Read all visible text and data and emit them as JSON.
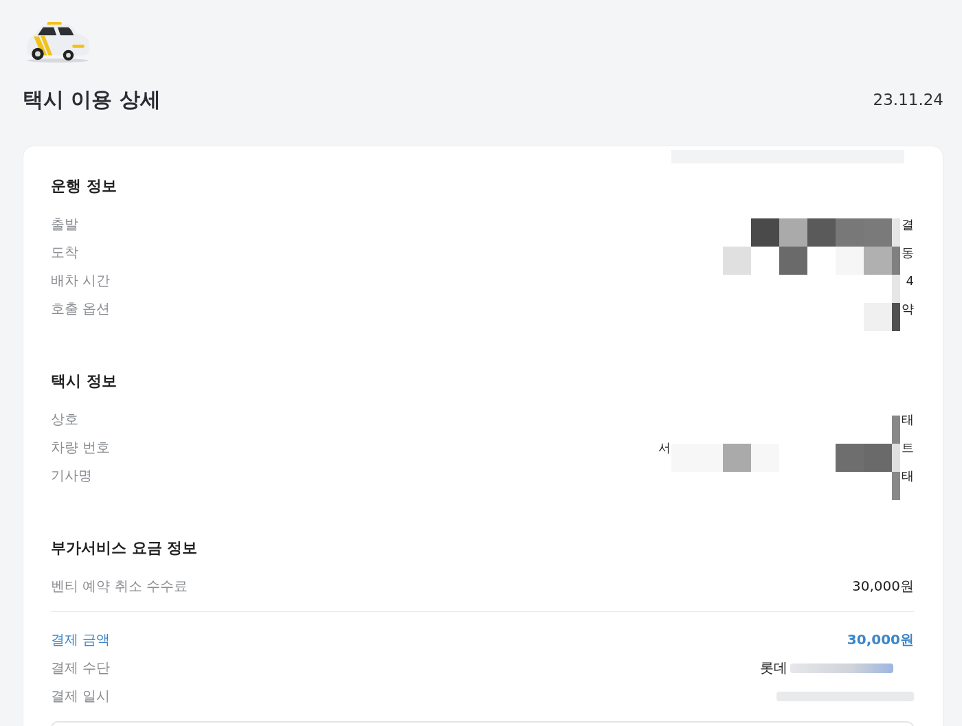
{
  "header": {
    "title": "택시 이용 상세",
    "date": "23.11.24"
  },
  "sections": [
    {
      "kind": "info",
      "heading": "운행 정보",
      "rows": [
        {
          "label": "출발",
          "value": "결"
        },
        {
          "label": "도착",
          "value": "동"
        },
        {
          "label": "배차 시간",
          "value": "4"
        },
        {
          "label": "호출 옵션",
          "value": "약"
        }
      ]
    },
    {
      "kind": "info",
      "heading": "택시 정보",
      "rows": [
        {
          "label": "상호",
          "value": "태"
        },
        {
          "label": "차량 번호",
          "value_left": "서",
          "value": "트"
        },
        {
          "label": "기사명",
          "value": "태"
        }
      ]
    },
    {
      "kind": "fees",
      "heading": "부가서비스 요금 정보",
      "rows": [
        {
          "label": "벤티 예약 취소 수수료",
          "value": "30,000원"
        }
      ]
    }
  ],
  "payment": {
    "total_label": "결제 금액",
    "total_value": "30,000원",
    "rows": [
      {
        "label": "결제 수단",
        "value": "롯데"
      },
      {
        "label": "결제 일시"
      }
    ]
  }
}
